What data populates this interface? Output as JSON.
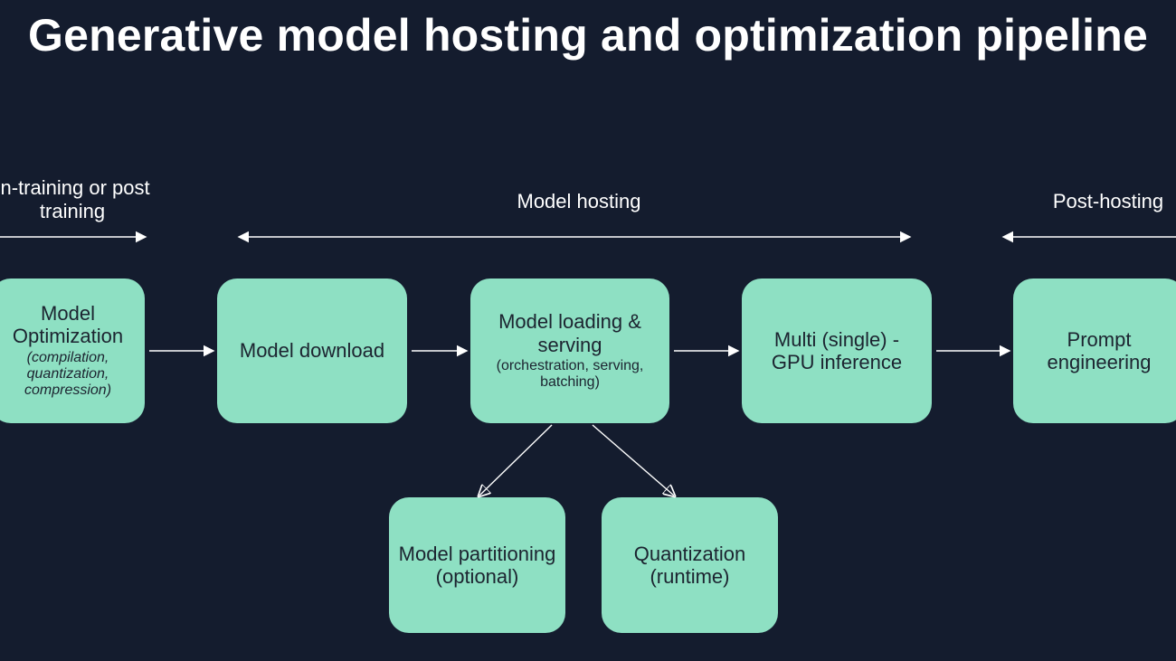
{
  "title": "Generative model hosting and optimization pipeline",
  "sections": {
    "s1": "In-training or post training",
    "s2": "Model hosting",
    "s3": "Post-hosting"
  },
  "boxes": {
    "opt": {
      "title": "Model Optimization",
      "sub": "(compilation, quantization, compression)"
    },
    "download": {
      "title": "Model download"
    },
    "loading": {
      "title": "Model loading & serving",
      "sub": "(orchestration, serving, batching)"
    },
    "gpu": {
      "title": "Multi (single) - GPU inference"
    },
    "prompt": {
      "title": "Prompt engineering"
    },
    "partition": {
      "title": "Model partitioning (optional)"
    },
    "quant": {
      "title": "Quantization (runtime)"
    }
  },
  "colors": {
    "bg": "#141c2e",
    "box": "#8ee0c3",
    "text": "#ffffff"
  }
}
